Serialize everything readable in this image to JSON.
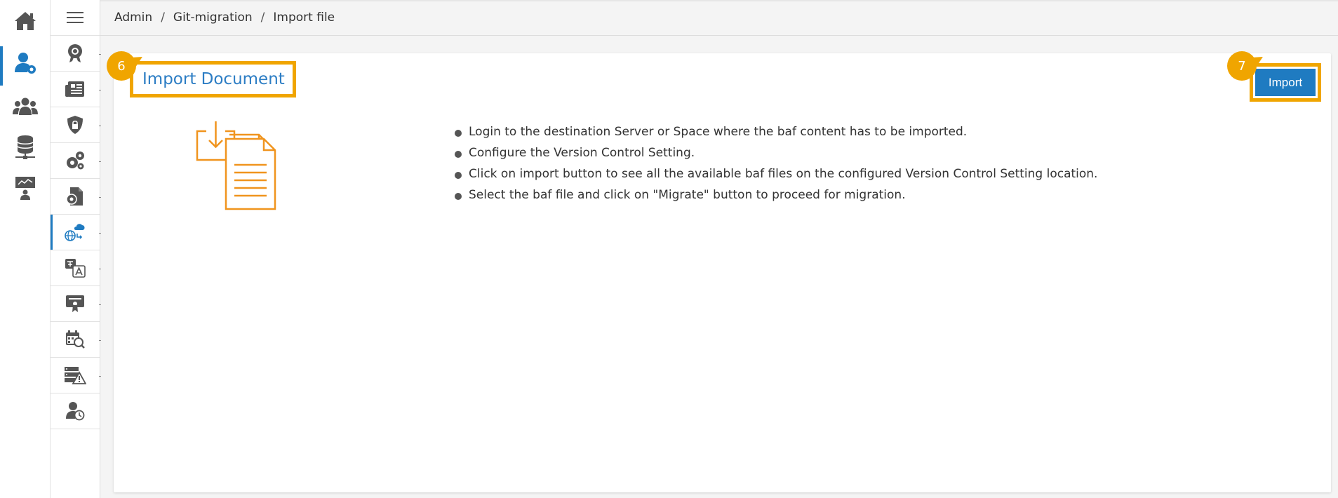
{
  "breadcrumb": [
    "Admin",
    "Git-migration",
    "Import file"
  ],
  "page_title": "Import Document",
  "import_button": "Import",
  "step_badges": {
    "title": "6",
    "import": "7"
  },
  "instructions": [
    "Login to the destination Server or Space where the baf content has to be imported.",
    "Configure the Version Control Setting.",
    "Click on import button to see all the available baf files on the configured Version Control Setting location.",
    "Select the baf file and click on \"Migrate\" button to proceed for migration."
  ],
  "rail_icons": [
    "home-icon",
    "user-settings-icon",
    "users-group-icon",
    "database-network-icon",
    "presentation-user-icon"
  ],
  "subnav_icons": [
    "award-gear-icon",
    "news-list-icon",
    "shield-lock-icon",
    "gears-icon",
    "file-gear-icon",
    "globe-cloud-sync-icon",
    "translate-icon",
    "certificate-monitor-icon",
    "calendar-search-icon",
    "server-warning-icon",
    "user-clock-icon"
  ],
  "colors": {
    "accent": "#1f7bc1",
    "highlight": "#f0a500",
    "title": "#2c7dc4",
    "icon_gray": "#555555",
    "illustration": "#f0941e"
  }
}
